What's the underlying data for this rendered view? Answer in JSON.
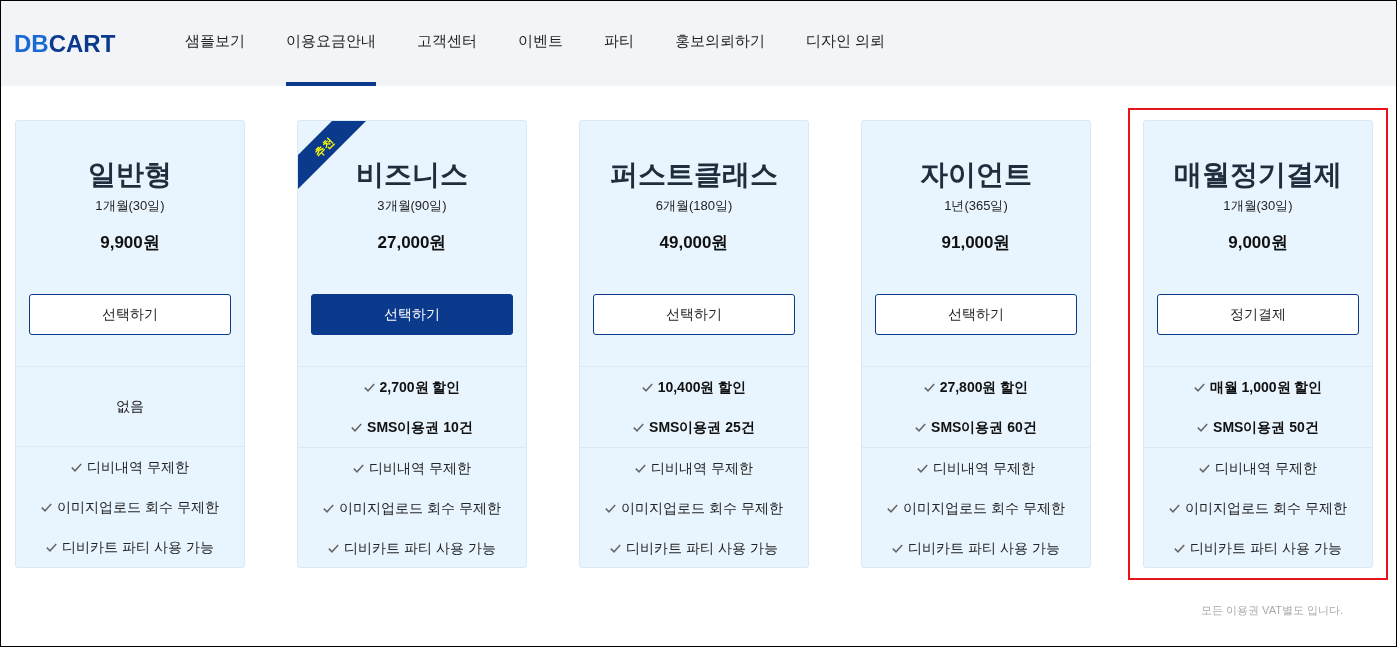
{
  "header": {
    "logo": {
      "accent": "DB",
      "main": "CART"
    },
    "nav": [
      {
        "label": "샘플보기",
        "selected": false
      },
      {
        "label": "이용요금안내",
        "selected": true
      },
      {
        "label": "고객센터",
        "selected": false
      },
      {
        "label": "이벤트",
        "selected": false
      },
      {
        "label": "파티",
        "selected": false
      },
      {
        "label": "홍보의뢰하기",
        "selected": false
      },
      {
        "label": "디자인 의뢰",
        "selected": false
      }
    ]
  },
  "plans": [
    {
      "name": "일반형",
      "period": "1개월(30일)",
      "price": "9,900원",
      "button": {
        "label": "선택하기",
        "selected": false
      },
      "bonus_note": "없음",
      "features": [
        "디비내역 무제한",
        "이미지업로드 회수 무제한",
        "디비카트 파티 사용 가능"
      ],
      "highlighted": false
    },
    {
      "name": "비즈니스",
      "ribbon": "추천",
      "period": "3개월(90일)",
      "price": "27,000원",
      "button": {
        "label": "선택하기",
        "selected": true
      },
      "bonuses": [
        "2,700원 할인",
        "SMS이용권 10건"
      ],
      "features": [
        "디비내역 무제한",
        "이미지업로드 회수 무제한",
        "디비카트 파티 사용 가능"
      ],
      "highlighted": false
    },
    {
      "name": "퍼스트클래스",
      "period": "6개월(180일)",
      "price": "49,000원",
      "button": {
        "label": "선택하기",
        "selected": false
      },
      "bonuses": [
        "10,400원 할인",
        "SMS이용권 25건"
      ],
      "features": [
        "디비내역 무제한",
        "이미지업로드 회수 무제한",
        "디비카트 파티 사용 가능"
      ],
      "highlighted": false
    },
    {
      "name": "자이언트",
      "period": "1년(365일)",
      "price": "91,000원",
      "button": {
        "label": "선택하기",
        "selected": false
      },
      "bonuses": [
        "27,800원 할인",
        "SMS이용권 60건"
      ],
      "features": [
        "디비내역 무제한",
        "이미지업로드 회수 무제한",
        "디비카트 파티 사용 가능"
      ],
      "highlighted": false
    },
    {
      "name": "매월정기결제",
      "period": "1개월(30일)",
      "price": "9,000원",
      "button": {
        "label": "정기결제",
        "selected": false
      },
      "bonuses": [
        "매월 1,000원 할인",
        "SMS이용권 50건"
      ],
      "features": [
        "디비내역 무제한",
        "이미지업로드 회수 무제한",
        "디비카트 파티 사용 가능"
      ],
      "highlighted": true
    }
  ],
  "footnote": "모든 이용권 VAT별도 입니다."
}
